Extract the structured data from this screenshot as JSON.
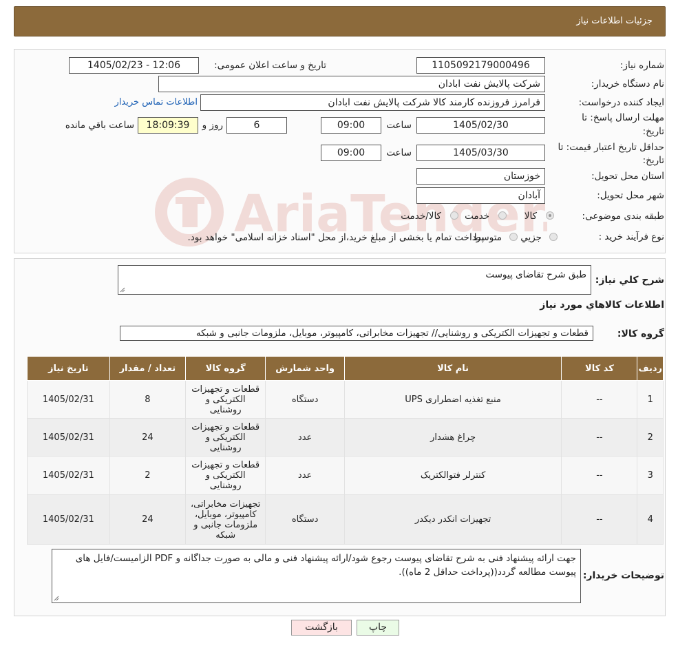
{
  "header": {
    "title": "جزئیات اطلاعات نیاز"
  },
  "form": {
    "need_number_label": "شماره نیاز:",
    "need_number": "1105092179000496",
    "announce_label": "تاریخ و ساعت اعلان عمومی:",
    "announce_value": "1405/02/23 - 12:06",
    "buyer_org_label": "نام دستگاه خریدار:",
    "buyer_org": "شرکت پالایش نفت ابادان",
    "creator_label": "ایجاد کننده درخواست:",
    "creator": "فرامرز فروزنده کارمند کالا شرکت پالایش نفت ابادان",
    "contact_link": "اطلاعات تماس خریدار",
    "reply_deadline_label": "مهلت ارسال پاسخ: تا",
    "reply_deadline_label2": "تاریخ:",
    "reply_date": "1405/02/30",
    "time_label": "ساعت",
    "reply_time": "09:00",
    "days_value": "6",
    "days_label": "روز و",
    "remaining_time": "18:09:39",
    "remaining_label": "ساعت باقي مانده",
    "validity_label": "حداقل تاریخ اعتبار قیمت: تا",
    "validity_label2": "تاریخ:",
    "validity_date": "1405/03/30",
    "validity_time": "09:00",
    "province_label": "استان محل تحویل:",
    "province": "خوزستان",
    "city_label": "شهر محل تحویل:",
    "city": "آبادان",
    "category_label": "طبقه بندی موضوعی:",
    "category_options": [
      "کالا",
      "خدمت",
      "کالا/خدمت"
    ],
    "category_selected": "کالا",
    "process_label": "نوع فرآیند خرید :",
    "process_options": [
      "جزيي",
      "متوسط"
    ],
    "process_note": "پرداخت تمام یا بخشی از مبلغ خرید،از محل \"اسناد خزانه اسلامی\" خواهد بود."
  },
  "summary": {
    "description_label": "شرح کلي نياز:",
    "description": "طبق شرح تقاضای پیوست",
    "goods_info_title": "اطلاعات کالاهاي مورد نياز",
    "goods_group_label": "گروه کالا:",
    "goods_group": "قطعات و تجهیزات الکتریکی و روشنایی// تجهیزات مخابراتی، کامپیوتر، موبایل، ملزومات جانبی و شبکه"
  },
  "table": {
    "headers": [
      "رديف",
      "کد کالا",
      "نام کالا",
      "واحد شمارش",
      "گروه کالا",
      "تعداد / مقدار",
      "تاريخ نياز"
    ],
    "rows": [
      [
        "1",
        "--",
        "منبع تغذیه اضطراری UPS",
        "دستگاه",
        "قطعات و تجهیزات الکتریکی و روشنایی",
        "8",
        "1405/02/31"
      ],
      [
        "2",
        "--",
        "چراغ هشدار",
        "عدد",
        "قطعات و تجهیزات الکتریکی و روشنایی",
        "24",
        "1405/02/31"
      ],
      [
        "3",
        "--",
        "کنترلر فتوالکتریک",
        "عدد",
        "قطعات و تجهیزات الکتریکی و روشنایی",
        "2",
        "1405/02/31"
      ],
      [
        "4",
        "--",
        "تجهیزات انکدر دیکدر",
        "دستگاه",
        "تجهیزات مخابراتی، کامپیوتر، موبایل، ملزومات جانبی و شبکه",
        "24",
        "1405/02/31"
      ]
    ]
  },
  "buyer_notes": {
    "label": "توضیحات خریدار:",
    "text": "جهت ارائه پیشنهاد فنی به شرح تقاضای پیوست رجوع شود/ارائه پیشنهاد فنی و مالی به صورت جداگانه و PDF الزامیست/فایل های پیوست مطالعه گردد((پرداخت حداقل 2 ماه))."
  },
  "buttons": {
    "print": "چاپ",
    "back": "بازگشت"
  },
  "watermark": {
    "text": "AriaTender.neT"
  },
  "colors": {
    "header_bg": "#8c6a3b",
    "link": "#1a5fb4",
    "highlight": "#ffffcc",
    "back_btn": "#fde4e4",
    "print_btn": "#eafbe6"
  }
}
